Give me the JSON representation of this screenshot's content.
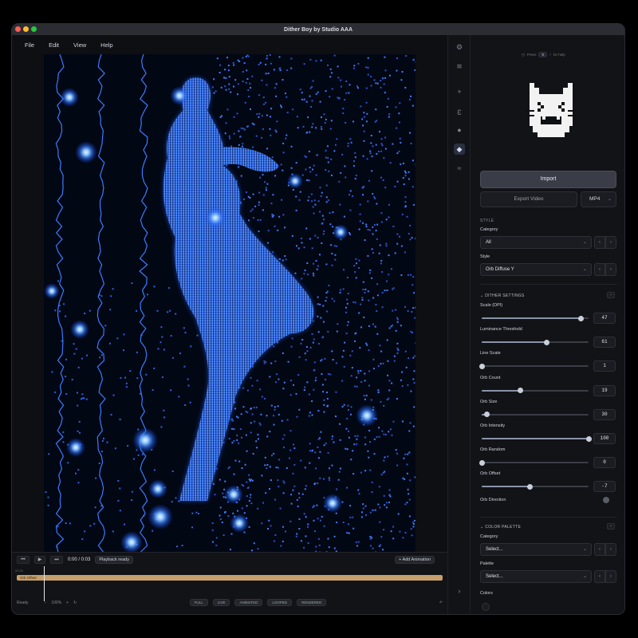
{
  "window": {
    "title": "Dither Boy by Studio AAA"
  },
  "menu": [
    "File",
    "Edit",
    "View",
    "Help"
  ],
  "timeline": {
    "time": "0:00 / 0:03",
    "status_badge": "Playback ready",
    "add_animation": "+ Add Animation",
    "ruler_start": "00:00",
    "track_label": "Orb Offset"
  },
  "statusbar": {
    "ready": "Ready",
    "zoom": "100%",
    "pills": [
      "FULL",
      "LIVE",
      "ANIMATED",
      "LOOPED",
      "RENDERED"
    ]
  },
  "panel": {
    "top_hint": {
      "before": "Press",
      "key": "K",
      "after": "for help"
    },
    "import_label": "Import",
    "export_label": "Export Video",
    "format": "MP4",
    "style_section": "STYLE",
    "category_label": "Category",
    "category_value": "All",
    "style_label": "Style",
    "style_value": "Orb Diffuse Y",
    "dither_section": "DITHER SETTINGS",
    "params": [
      {
        "label": "Scale (DPI)",
        "value": "47",
        "fraction": 0.93
      },
      {
        "label": "Luminance Threshold",
        "value": "61",
        "fraction": 0.61
      },
      {
        "label": "Line Scale",
        "value": "1",
        "fraction": 0.0
      },
      {
        "label": "Orb Count",
        "value": "19",
        "fraction": 0.36
      },
      {
        "label": "Orb Size",
        "value": "30",
        "fraction": 0.05
      },
      {
        "label": "Orb Intensity",
        "value": "100",
        "fraction": 1.0
      },
      {
        "label": "Orb Random",
        "value": "0",
        "fraction": 0.0
      },
      {
        "label": "Orb Offset",
        "value": "-7",
        "fraction": 0.45
      }
    ],
    "orb_direction_label": "Orb Direction",
    "palette_section": "COLOR PALETTE",
    "palette_category_label": "Category",
    "palette_category_value": "Select...",
    "palette_label": "Palette",
    "palette_value": "Select...",
    "colors_label": "Colors"
  },
  "colors": {
    "accent_track": "#c5a06b",
    "glow": "#3f8cff"
  }
}
